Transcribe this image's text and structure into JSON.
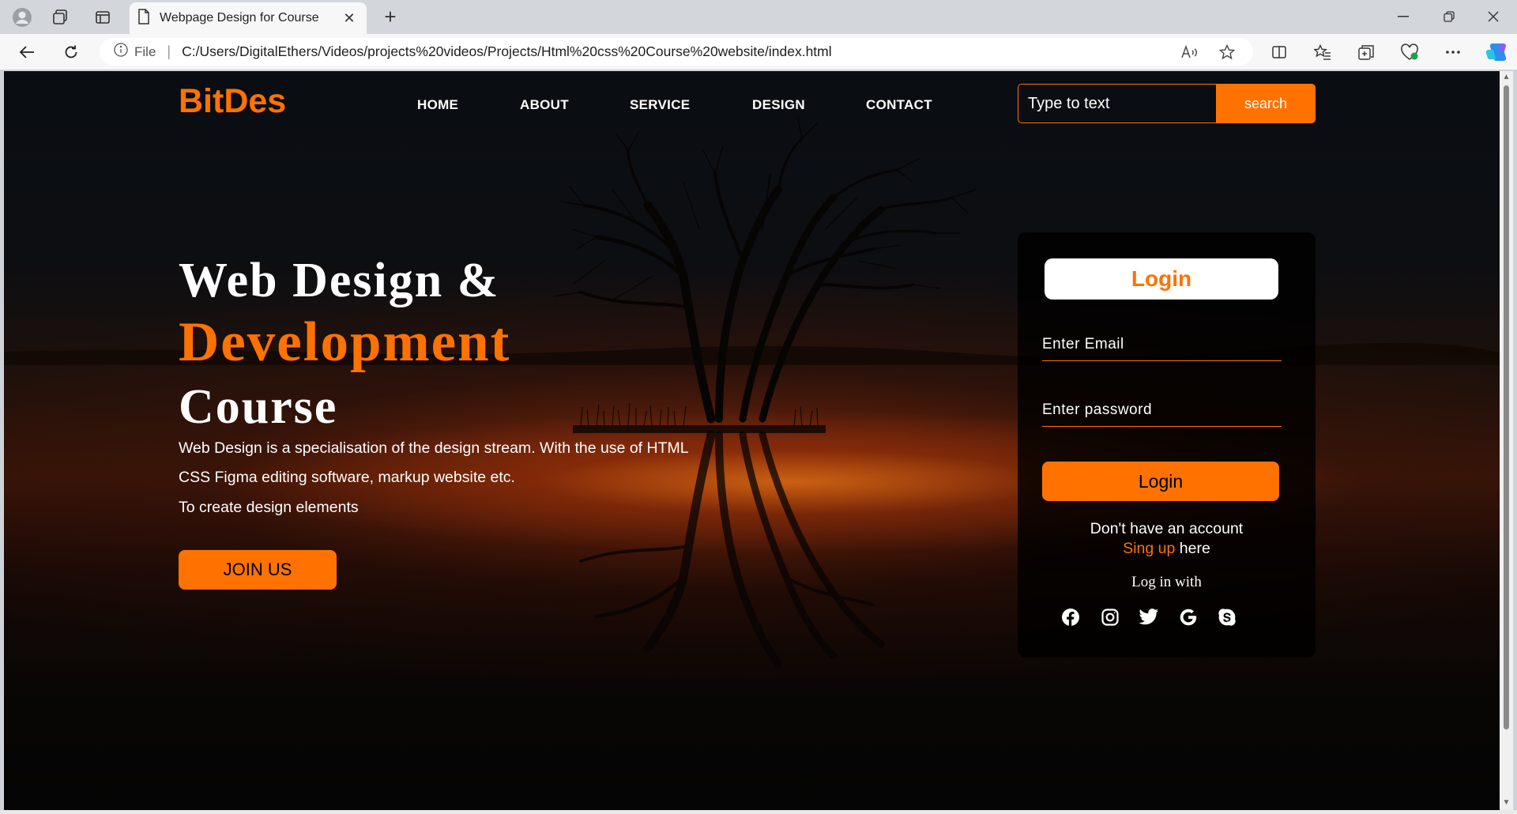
{
  "browser": {
    "tab_title": "Webpage Design for Course",
    "new_tab_label": "+",
    "file_label": "File",
    "url": "C:/Users/DigitalEthers/Videos/projects%20videos/Projects/Html%20css%20Course%20website/index.html"
  },
  "nav": {
    "logo": "BitDes",
    "links": [
      "HOME",
      "ABOUT",
      "SERVICE",
      "DESIGN",
      "CONTACT"
    ],
    "search_placeholder": "Type to text",
    "search_button": "search"
  },
  "hero": {
    "line1": "Web Design &",
    "line2": "Development",
    "line3": "Course",
    "para1": "Web Design is a specialisation of the design stream. With the use of HTML",
    "para2": "CSS Figma editing software, markup website etc.",
    "para3": "To create design elements",
    "join_button": "JOIN US"
  },
  "login": {
    "title": "Login",
    "email_placeholder": "Enter Email",
    "password_placeholder": "Enter password",
    "button": "Login",
    "no_account": "Don't have an account",
    "signup_link": "Sing up",
    "signup_suffix": " here",
    "login_with": "Log in with",
    "social_icons": [
      "facebook-icon",
      "instagram-icon",
      "twitter-icon",
      "google-icon",
      "skype-icon"
    ]
  },
  "colors": {
    "accent": "#ff7200",
    "text": "#ffffff"
  }
}
